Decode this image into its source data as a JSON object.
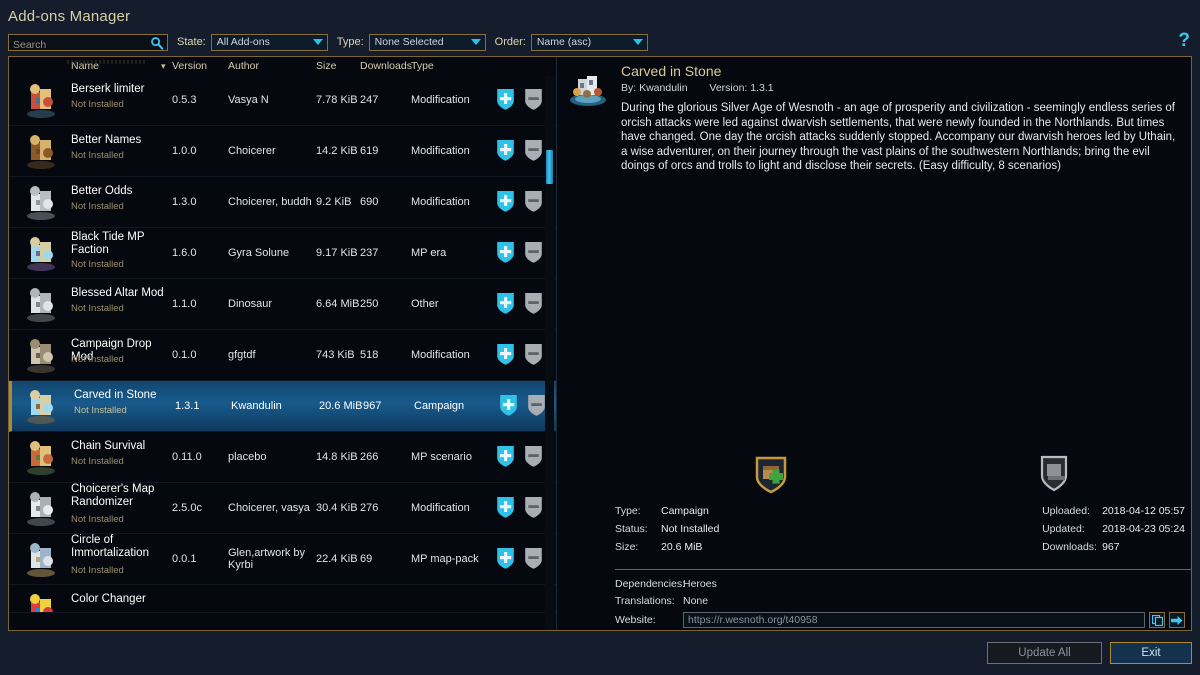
{
  "window": {
    "title": "Add-ons Manager"
  },
  "toolbar": {
    "search_placeholder": "Search",
    "search_value": "",
    "search_icon": "magnifier-icon",
    "state_label": "State:",
    "state_value": "All Add-ons",
    "type_label": "Type:",
    "type_value": "None Selected",
    "order_label": "Order:",
    "order_value": "Name (asc)",
    "help_icon": "question-mark-icon"
  },
  "list": {
    "headers": {
      "name": "Name",
      "sort_icon": "sort-chevron-icon",
      "version": "Version",
      "author": "Author",
      "size": "Size",
      "downloads": "Downloads",
      "type": "Type"
    },
    "install_icon": "shield-plus-install-icon",
    "uninstall_icon": "shield-minus-uninstall-icon",
    "rows": [
      {
        "name": "Berserk limiter",
        "status": "Not Installed",
        "version": "0.5.3",
        "author": "Vasya N",
        "size": "7.78 KiB",
        "downloads": "247",
        "type": "Modification",
        "selected": false
      },
      {
        "name": "Better Names",
        "status": "Not Installed",
        "version": "1.0.0",
        "author": "Choicerer",
        "size": "14.2 KiB",
        "downloads": "619",
        "type": "Modification",
        "selected": false
      },
      {
        "name": "Better Odds",
        "status": "Not Installed",
        "version": "1.3.0",
        "author": "Choicerer, buddh",
        "size": "9.2 KiB",
        "downloads": "690",
        "type": "Modification",
        "selected": false
      },
      {
        "name": "Black Tide MP Faction",
        "status": "Not Installed",
        "version": "1.6.0",
        "author": "Gyra Solune",
        "size": "9.17 KiB",
        "downloads": "237",
        "type": "MP era",
        "selected": false
      },
      {
        "name": "Blessed Altar Mod",
        "status": "Not Installed",
        "version": "1.1.0",
        "author": "Dinosaur",
        "size": "6.64 MiB",
        "downloads": "250",
        "type": "Other",
        "selected": false
      },
      {
        "name": "Campaign Drop Mod",
        "status": "Not Installed",
        "version": "0.1.0",
        "author": "gfgtdf",
        "size": "743 KiB",
        "downloads": "518",
        "type": "Modification",
        "selected": false
      },
      {
        "name": "Carved in Stone",
        "status": "Not Installed",
        "version": "1.3.1",
        "author": "Kwandulin",
        "size": "20.6 MiB",
        "downloads": "967",
        "type": "Campaign",
        "selected": true
      },
      {
        "name": "Chain Survival",
        "status": "Not Installed",
        "version": "0.11.0",
        "author": "placebo",
        "size": "14.8 KiB",
        "downloads": "266",
        "type": "MP scenario",
        "selected": false
      },
      {
        "name": "Choicerer's Map Randomizer",
        "status": "Not Installed",
        "version": "2.5.0c",
        "author": "Choicerer, vasya",
        "size": "30.4 KiB",
        "downloads": "276",
        "type": "Modification",
        "selected": false
      },
      {
        "name": "Circle of Immortalization",
        "status": "Not Installed",
        "version": "0.0.1",
        "author": "Glen,artwork by Kyrbi",
        "size": "22.4 KiB",
        "downloads": "69",
        "type": "MP map-pack",
        "selected": false
      },
      {
        "name": "Color Changer",
        "status": "",
        "version": "",
        "author": "",
        "size": "",
        "downloads": "",
        "type": "",
        "selected": false
      }
    ]
  },
  "detail": {
    "title": "Carved in Stone",
    "by_label": "By:",
    "by_value": "Kwandulin",
    "version_label": "Version:",
    "version_value": "1.3.1",
    "description": "During the glorious Silver Age of Wesnoth - an age of prosperity and civilization - seemingly endless series of orcish attacks were led against dwarvish settlements, that were newly founded in the Northlands. But times have changed. One day the orcish attacks suddenly stopped. Accompany our dwarvish heroes led by Uthain, a wise adventurer, on their journey through the vast plains of the southwestern Northlands; bring the evil doings of orcs and trolls to light and disclose their secrets. (Easy difficulty, 8 scenarios)",
    "install_icon": "shield-install-large-icon",
    "uninstall_icon": "shield-uninstall-large-icon",
    "info": {
      "type_label": "Type:",
      "type_value": "Campaign",
      "status_label": "Status:",
      "status_value": "Not Installed",
      "size_label": "Size:",
      "size_value": "20.6 MiB",
      "uploaded_label": "Uploaded:",
      "uploaded_value": "2018-04-12 05:57",
      "updated_label": "Updated:",
      "updated_value": "2018-04-23 05:24",
      "downloads_label": "Downloads:",
      "downloads_value": "967"
    },
    "extra": {
      "dependencies_label": "Dependencies:",
      "dependencies_value": "Heroes",
      "translations_label": "Translations:",
      "translations_value": "None",
      "website_label": "Website:",
      "website_value": "https://r.wesnoth.org/t40958",
      "copy_icon": "copy-icon",
      "open_icon": "arrow-right-open-icon"
    }
  },
  "footer": {
    "update_all_label": "Update All",
    "exit_label": "Exit"
  },
  "colors": {
    "accent_gold": "#b08a32",
    "accent_cyan": "#3ec8ef",
    "panel_bg": "#05080f",
    "window_bg": "#151c2b",
    "selected_row": "#185a8c"
  }
}
